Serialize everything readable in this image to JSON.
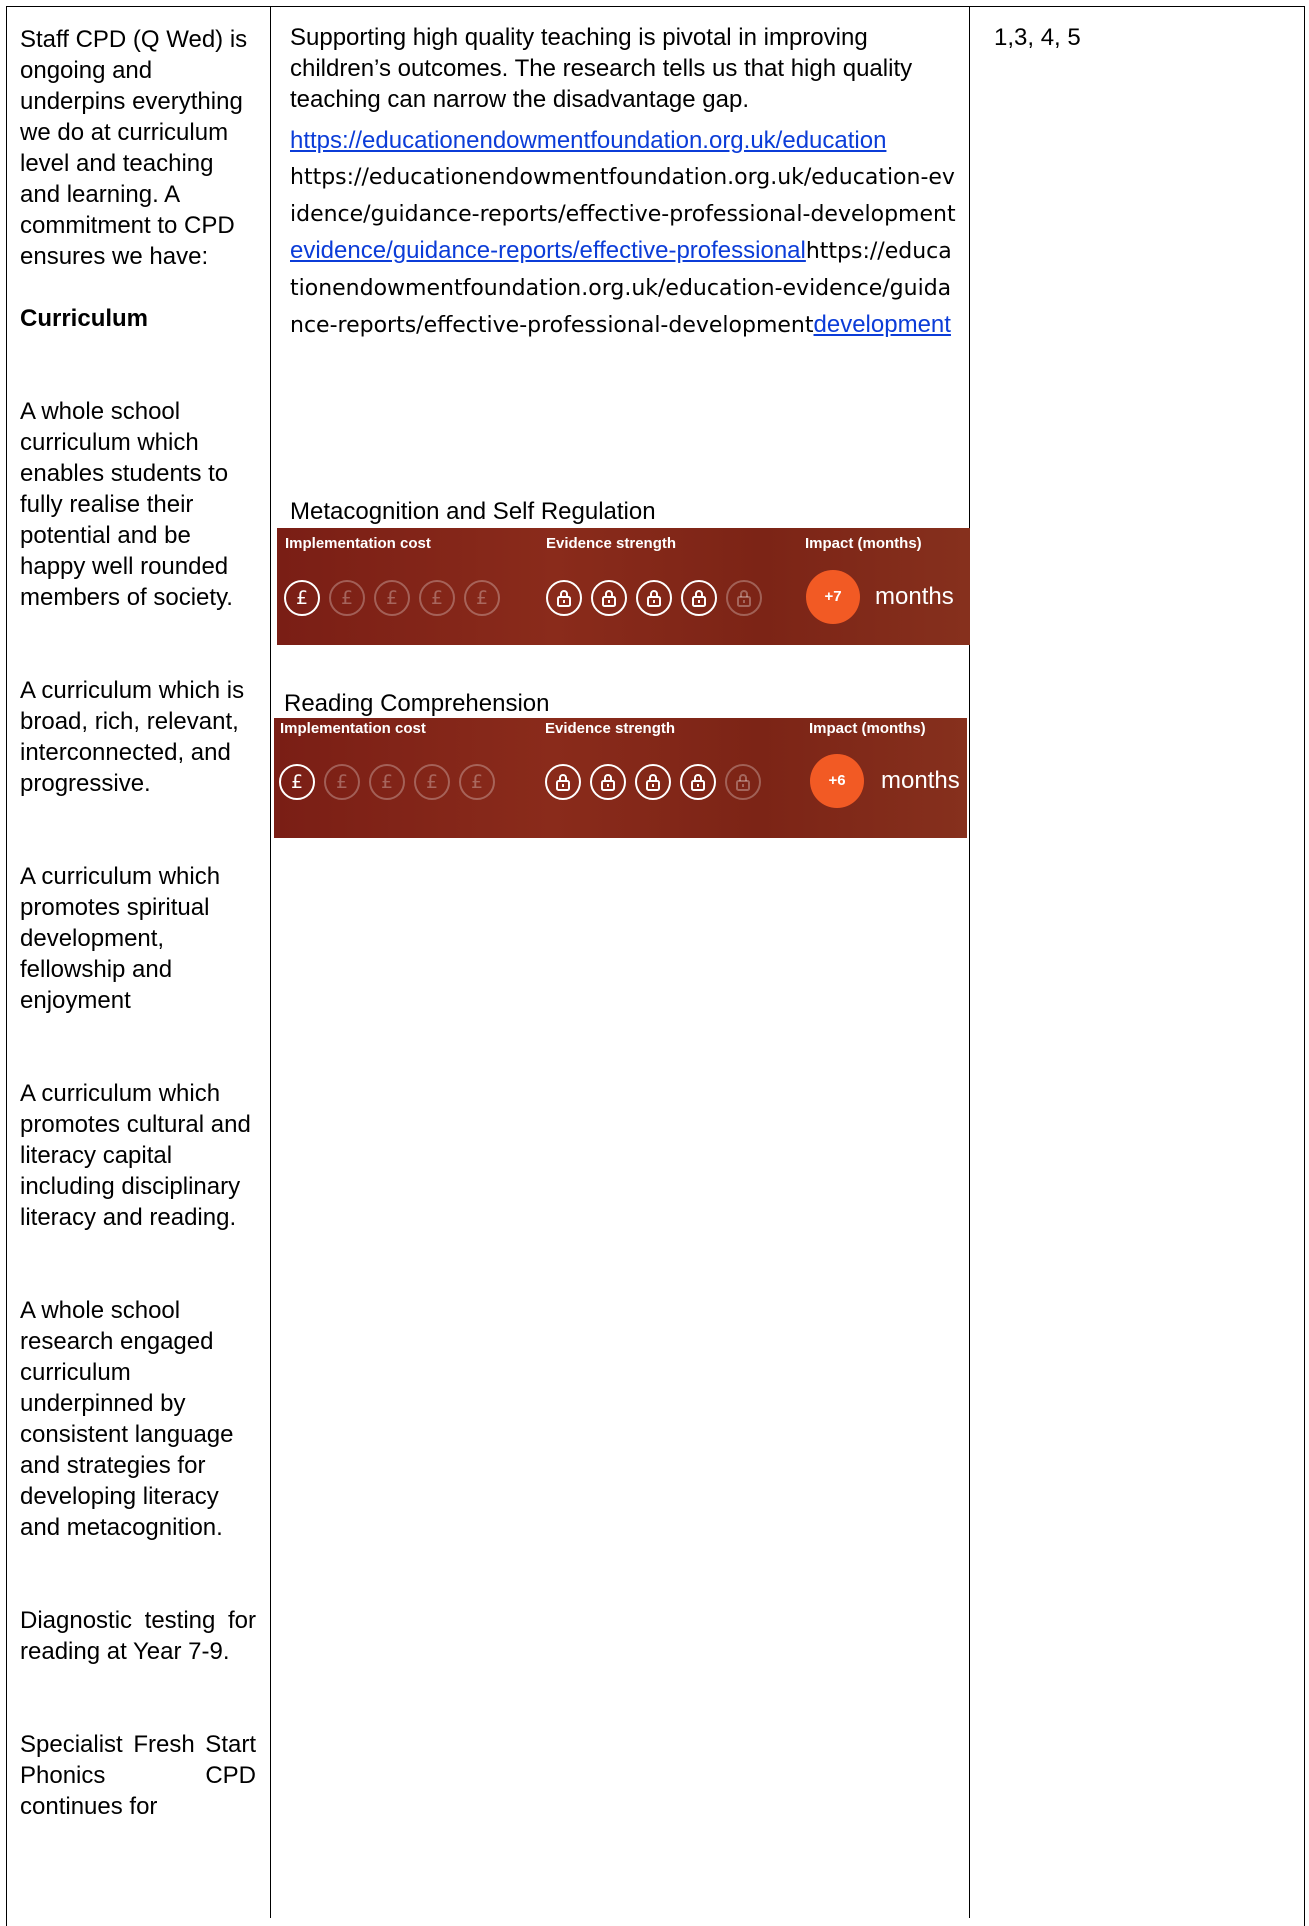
{
  "column1": {
    "intro": "Staff CPD (Q Wed) is ongoing and underpins everything we do at curriculum level and teaching and learning. A commitment to CPD ensures we have:",
    "heading": "Curriculum",
    "items": [
      "A whole school curriculum which enables students to fully realise their potential and be happy well rounded members of society.",
      "A curriculum which is broad, rich, relevant, interconnected, and progressive.",
      "A curriculum which promotes spiritual development, fellowship and enjoyment",
      "A curriculum which promotes cultural and literacy capital including disciplinary literacy and reading.",
      "A whole school research engaged curriculum underpinned by consistent language and strategies for developing literacy and metacognition.",
      "Diagnostic testing for reading at Year 7-9.",
      "Specialist Fresh Start Phonics CPD continues for"
    ]
  },
  "column2": {
    "intro": "Supporting high quality teaching is pivotal in improving children’s outcomes. The research tells us that high quality teaching can narrow the disadvantage gap.",
    "link_1": "https://educationendowmentfoundation.org.uk/education",
    "text_1": "https://educationendowmentfoundation.org.uk/education-evidence/guidance-reports/effective-professional-development",
    "link_2": "evidence/guidance-reports/effective-professional",
    "text_2": "https://educationendowmentfoundation.org.uk/education-evidence/guidance-reports/effective-professional-development",
    "link_3": "development",
    "cards": [
      {
        "title": "Metacognition and Self Regulation",
        "cost_label": "Implementation cost",
        "evidence_label": "Evidence strength",
        "impact_label": "Impact (months)",
        "cost_level": 1,
        "cost_max": 5,
        "evidence_level": 4,
        "evidence_max": 5,
        "impact_value": "+7",
        "impact_unit": "months"
      },
      {
        "title": "Reading Comprehension",
        "cost_label": "Implementation cost",
        "evidence_label": "Evidence strength",
        "impact_label": "Impact (months)",
        "cost_level": 1,
        "cost_max": 5,
        "evidence_level": 4,
        "evidence_max": 5,
        "impact_value": "+6",
        "impact_unit": "months"
      }
    ],
    "cost_symbol": "£",
    "lock_icon": "lock-icon",
    "accent_color": "#f25a24",
    "banner_color": "#7f2517"
  },
  "column3": {
    "challenges": "1,3, 4, 5"
  }
}
